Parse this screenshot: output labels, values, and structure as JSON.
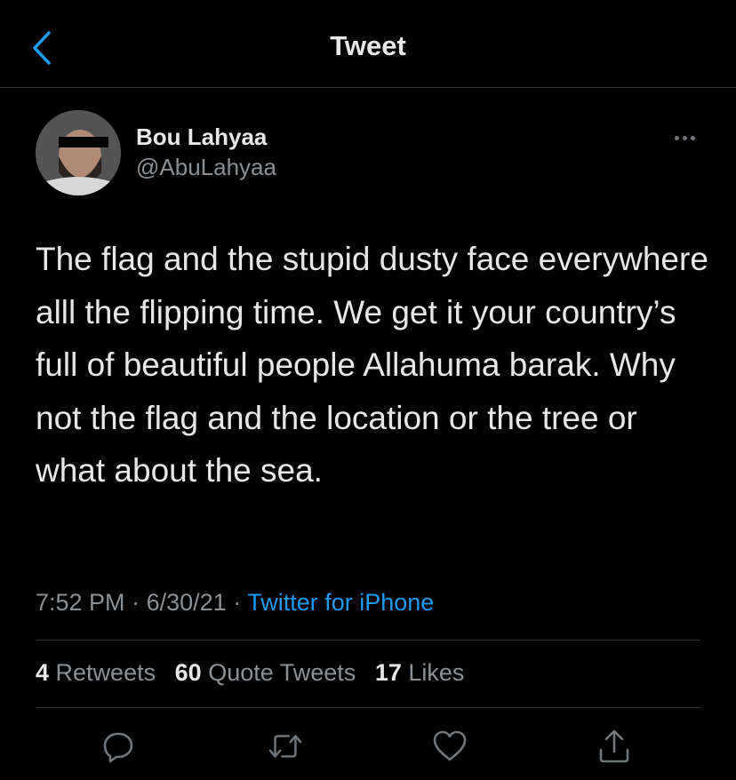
{
  "header": {
    "title": "Tweet"
  },
  "tweet": {
    "author": {
      "name": "Bou Lahyaa",
      "handle": "@AbuLahyaa"
    },
    "text": "The flag and the stupid dusty face everywhere alll the flipping time. We get it your country’s full of beautiful people Allahuma barak. Why not the flag and the location or the tree or what about the sea.",
    "time": "7:52 PM",
    "date": "6/30/21",
    "source": "Twitter for iPhone"
  },
  "stats": {
    "retweets_count": "4",
    "retweets_label": "Retweets",
    "quotes_count": "60",
    "quotes_label": "Quote Tweets",
    "likes_count": "17",
    "likes_label": "Likes"
  },
  "colors": {
    "background": "#000000",
    "accent": "#1d9bf0",
    "muted": "#8b9095",
    "text": "#e7e7e7"
  },
  "icons": [
    "back-icon",
    "more-icon",
    "reply-icon",
    "retweet-icon",
    "like-icon",
    "share-icon"
  ]
}
